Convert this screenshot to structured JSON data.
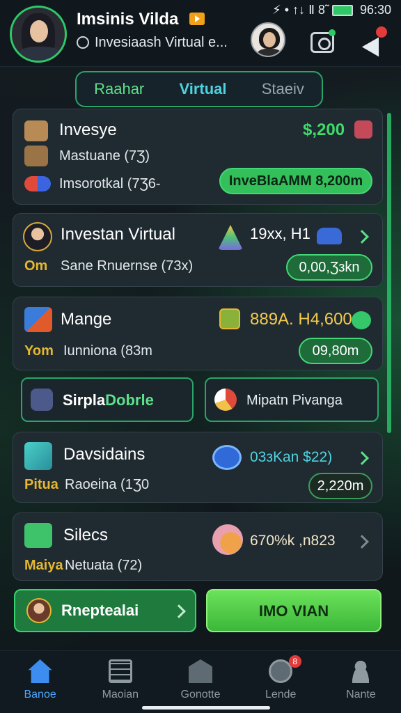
{
  "status_bar": {
    "time": "96:30",
    "signal_text": "⚡ • ↑↓ Ⅱ 8̃"
  },
  "header": {
    "title": "Imsinis Vilda",
    "subtitle": "Invesiaash Virtual e..."
  },
  "segmented": {
    "tabs": [
      "Raahar",
      "Virtual",
      "Staeiv"
    ],
    "active": "Virtual"
  },
  "cards": [
    {
      "title": "Invesye",
      "line2": "Mastuane (7Ʒ)",
      "line3": "Imsorotkal (7Ʒ6-",
      "amount": "$,200",
      "action": "InveBlaAMM 8,200m"
    },
    {
      "title": "Investan Virtual",
      "line2": "Sane Rnuernse (73х)",
      "line2_prefix": "Om",
      "amount": "19хх, H1",
      "action": "0,00,Ʒзkn"
    },
    {
      "title": "Mange",
      "line2": "Iunniona (83m",
      "line2_prefix": "Yom",
      "amount": "889А. H4,600",
      "action": "09,80m"
    },
    {
      "title": "Davsidains",
      "line2": "Raoeina (1Ʒ0",
      "line2_prefix": "Pitua",
      "amount": "03зKan $22)",
      "action": "2,220m"
    },
    {
      "title": "Silecs",
      "line2": "Netuata (72)",
      "line2_prefix": "Maiya",
      "amount": "670%k ,n823"
    }
  ],
  "mini_buttons": [
    {
      "label_a": "Sirpla",
      "label_b": "Dobrle"
    },
    {
      "label": "Mipatn Pivanga"
    }
  ],
  "bottom_buttons": {
    "left": "Rneptealai",
    "right": "IMO VIAN"
  },
  "tabbar": [
    {
      "label": "Banoe",
      "icon": "home-icon"
    },
    {
      "label": "Maoian",
      "icon": "calendar-icon"
    },
    {
      "label": "Gonotte",
      "icon": "mail-icon"
    },
    {
      "label": "Lende",
      "icon": "globe-icon",
      "badge": "8"
    },
    {
      "label": "Nante",
      "icon": "user-icon"
    }
  ],
  "colors": {
    "accent_green": "#2ec866",
    "accent_cyan": "#4fd3e0",
    "tab_active": "#4fa7ff",
    "bg": "#0d1519"
  }
}
